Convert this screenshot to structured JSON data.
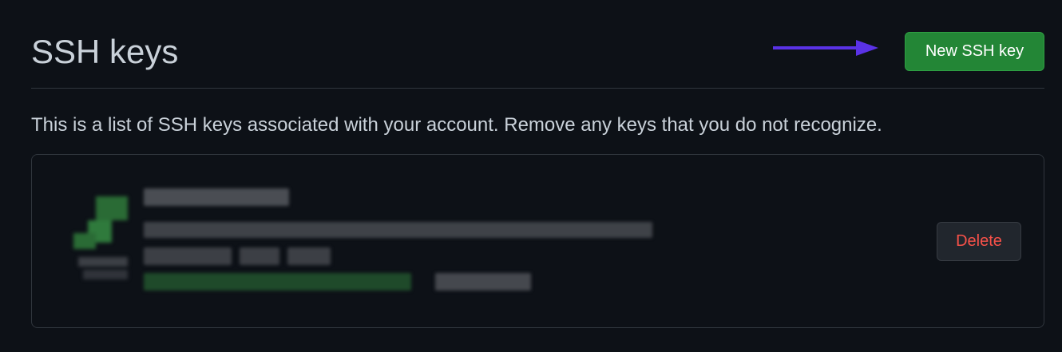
{
  "header": {
    "title": "SSH keys",
    "new_key_label": "New SSH key"
  },
  "description": "This is a list of SSH keys associated with your account. Remove any keys that you do not recognize.",
  "keys": [
    {
      "delete_label": "Delete"
    }
  ],
  "colors": {
    "background": "#0d1117",
    "primary_button": "#238636",
    "danger_text": "#f85149",
    "annotation_arrow": "#5a32e6"
  }
}
